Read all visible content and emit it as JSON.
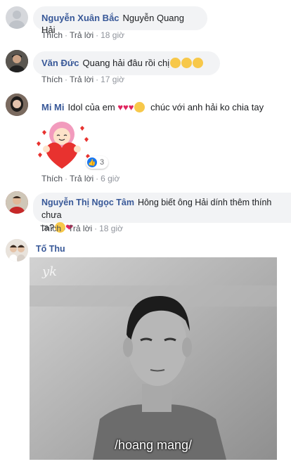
{
  "comments": [
    {
      "author": "Nguyễn Xuân Bắc",
      "text": "Nguyễn Quang Hải",
      "like": "Thích",
      "reply": "Trả lời",
      "time": "18 giờ"
    },
    {
      "author": "Văn Đức",
      "text": "Quang hải đâu rồi chị",
      "like": "Thích",
      "reply": "Trả lời",
      "time": "17 giờ"
    },
    {
      "author": "Mi Mi",
      "text": "Idol của em",
      "text2": "chúc với anh hải ko chia tay",
      "reaction_count": "3",
      "like": "Thích",
      "reply": "Trả lời",
      "time": "6 giờ"
    },
    {
      "author": "Nguyễn Thị Ngọc Tâm",
      "text": "Hông biết ông Hải dính thêm thính chưa",
      "text2": "ta?",
      "like": "Thích",
      "reply": "Trả lời",
      "time": "18 giờ"
    },
    {
      "author": "Tố Thu",
      "photo_caption": "/hoang mang/"
    }
  ],
  "colors": {
    "author": "#385898",
    "bubble": "#f2f3f5",
    "meta": "#90949c",
    "like_blue": "#1877f2"
  }
}
